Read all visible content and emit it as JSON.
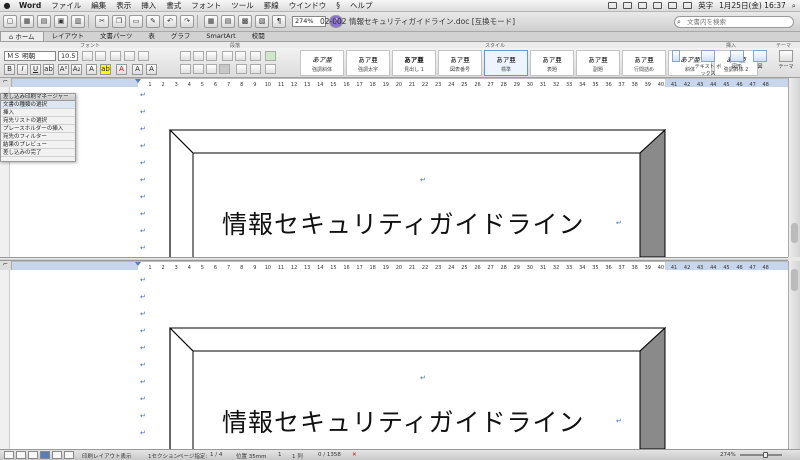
{
  "menubar": {
    "apple": "",
    "app": "Word",
    "items": [
      "ファイル",
      "編集",
      "表示",
      "挿入",
      "書式",
      "フォント",
      "ツール",
      "罫線",
      "ウインドウ",
      "ヘルプ"
    ],
    "script_icon": "§",
    "input_mode": "英字",
    "clock": "1月25日(金)  16:37"
  },
  "toolbar": {
    "zoom": "274%",
    "doc_title": "02-002 情報セキュリティガイドライン.doc [互換モード]",
    "search_placeholder": "文書内を検索"
  },
  "ribbon": {
    "tabs": [
      "ホーム",
      "レイアウト",
      "文書パーツ",
      "表",
      "グラフ",
      "SmartArt",
      "校閲"
    ],
    "group_labels": {
      "font": "フォント",
      "paragraph": "段落",
      "styles": "スタイル",
      "insert": "挿入",
      "theme": "テーマ"
    },
    "font_name": "ＭＳ 明朝",
    "font_size": "10.5",
    "styles": [
      {
        "sample": "あア亜",
        "name": "強調斜体"
      },
      {
        "sample": "あア亜",
        "name": "強調太字"
      },
      {
        "sample": "あア亜",
        "name": "見出し 1"
      },
      {
        "sample": "あア亜",
        "name": "図表番号"
      },
      {
        "sample": "あア亜",
        "name": "標準"
      },
      {
        "sample": "あア亜",
        "name": "表題"
      },
      {
        "sample": "あア亜",
        "name": "副題"
      },
      {
        "sample": "あア亜",
        "name": "行間詰め"
      },
      {
        "sample": "あア亜",
        "name": "斜体"
      },
      {
        "sample": "あア亜",
        "name": "強調斜体 2"
      }
    ],
    "insert_items": [
      "テキスト ボックス",
      "図形",
      "図"
    ],
    "theme_label": "テーマ"
  },
  "ruler_numbers": [
    "1",
    "2",
    "3",
    "4",
    "5",
    "6",
    "7",
    "8",
    "9",
    "10",
    "11",
    "12",
    "13",
    "14",
    "15",
    "16",
    "17",
    "18",
    "19",
    "20",
    "21",
    "22",
    "23",
    "24",
    "25",
    "26",
    "27",
    "28",
    "29",
    "30",
    "31",
    "32",
    "33",
    "34",
    "35",
    "36",
    "37",
    "38",
    "39",
    "40",
    "41",
    "42",
    "43",
    "44",
    "45",
    "46",
    "47",
    "48"
  ],
  "merge_manager": {
    "title": "差し込み印刷マネージャー",
    "items": [
      "文書の種類の選択",
      "挿入",
      "宛先リストの選択",
      "プレースホルダーの挿入",
      "宛先のフィルター",
      "結果のプレビュー",
      "差し込みの完了"
    ]
  },
  "document": {
    "title": "情報セキュリティガイドライン",
    "para_mark": "↵"
  },
  "status": {
    "view": "印刷レイアウト表示",
    "section": "1セクション",
    "page_label": "ページ指定:",
    "page": "1 / 4",
    "position": "位置 35mm",
    "line": "1",
    "col": "1 列",
    "words": "0 / 1358",
    "zoom": "274%"
  },
  "colors": {
    "accent": "#5a7fb8",
    "para": "#3a6fc9",
    "frame_dark": "#8a8a8a"
  }
}
